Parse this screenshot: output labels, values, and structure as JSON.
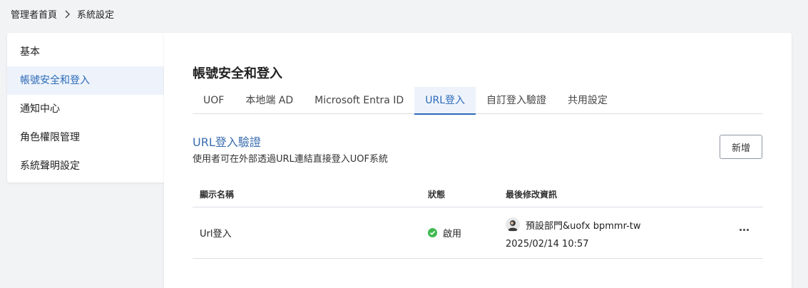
{
  "breadcrumb": {
    "home": "管理者首頁",
    "current": "系統設定"
  },
  "sidebar": {
    "items": [
      {
        "label": "基本"
      },
      {
        "label": "帳號安全和登入",
        "active": true
      },
      {
        "label": "通知中心"
      },
      {
        "label": "角色權限管理"
      },
      {
        "label": "系統聲明設定"
      }
    ]
  },
  "page": {
    "title": "帳號安全和登入"
  },
  "tabs": [
    {
      "label": "UOF"
    },
    {
      "label": "本地端 AD"
    },
    {
      "label": "Microsoft Entra ID"
    },
    {
      "label": "URL登入",
      "active": true
    },
    {
      "label": "自訂登入驗證"
    },
    {
      "label": "共用設定"
    }
  ],
  "section": {
    "title": "URL登入驗證",
    "description": "使用者可在外部透過URL連結直接登入UOF系統",
    "add_label": "新增"
  },
  "table": {
    "headers": {
      "name": "顯示名稱",
      "status": "狀態",
      "modified": "最後修改資訊"
    },
    "rows": [
      {
        "name": "Url登入",
        "status": "啟用",
        "modified_by": "預設部門&uofx bpmmr-tw",
        "modified_at": "2025/02/14 10:57"
      }
    ]
  },
  "colors": {
    "accent": "#2b6ab8",
    "section_title": "#3a6db0",
    "active_bg": "#eef3fb",
    "status_ok": "#3fb950"
  }
}
